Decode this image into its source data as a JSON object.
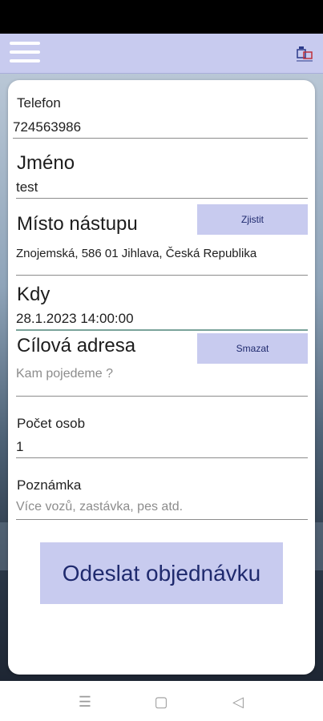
{
  "appbar": {
    "menu_icon": "hamburger-menu-icon",
    "logo_icon": "app-logo-icon"
  },
  "form": {
    "phone": {
      "label": "Telefon",
      "value": "724563986"
    },
    "name": {
      "label": "Jméno",
      "value": "test"
    },
    "pickup": {
      "label": "Místo nástupu",
      "value": "Znojemská, 586 01 Jihlava, Česká Republika",
      "button": "Zjistit"
    },
    "when": {
      "label": "Kdy",
      "value": "28.1.2023 14:00:00"
    },
    "destination": {
      "label": "Cílová adresa",
      "placeholder": "Kam pojedeme ?",
      "button": "Smazat"
    },
    "persons": {
      "label": "Počet osob",
      "value": "1"
    },
    "note": {
      "label": "Poznámka",
      "placeholder": "Více vozů, zastávka, pes atd."
    },
    "submit": "Odeslat objednávku"
  },
  "navbar": {
    "menu_icon": "☰",
    "home_icon": "▢",
    "back_icon": "◁"
  },
  "colors": {
    "accent": "#c8cbef",
    "accent_text": "#1f2a6e",
    "active_line": "#7aa39a"
  }
}
